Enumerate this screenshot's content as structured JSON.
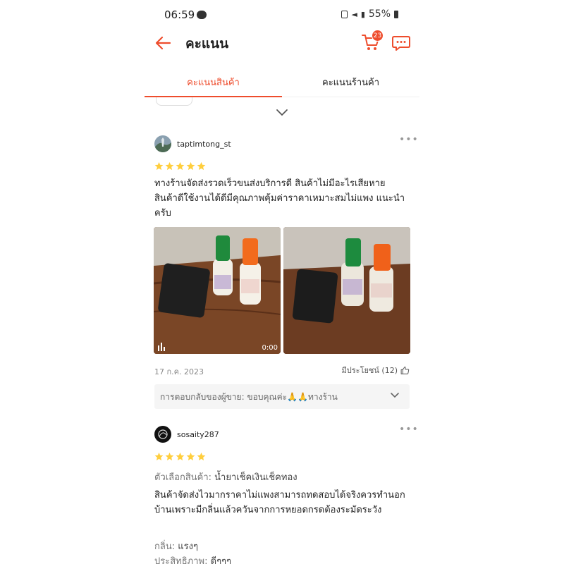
{
  "status": {
    "time": "06:59",
    "battery": "55%"
  },
  "appbar": {
    "title": "คะแนน",
    "cart_count": "23"
  },
  "tabs": [
    {
      "label": "คะแนนสินค้า"
    },
    {
      "label": "คะแนนร้านค้า"
    }
  ],
  "reviews": [
    {
      "username": "taptimtong_st",
      "rating": 5,
      "text": "ทางร้านจัดส่งรวดเร็วขนส่งบริการดี สินค้าไม่มีอะไรเสียหาย สินค้าดีใช้งานได้ดีมีคุณภาพคุ้มค่าราคาเหมาะสมไม่แพง แนะนำครับ",
      "video_duration": "0:00",
      "date": "17 ก.ค. 2023",
      "helpful": "มีประโยชน์ (12)",
      "seller_reply": "การตอบกลับของผู้ขาย: ขอบคุณค่ะ🙏🙏ทางร้าน"
    },
    {
      "username": "sosaity287",
      "rating": 5,
      "variant_label": "ตัวเลือกสินค้า:",
      "variant_value": "น้ำยาเช็คเงินเช็คทอง",
      "text": "สินค้าจัดส่งไวมากราคาไม่แพงสามารถทดสอบได้จริงควรทำนอกบ้านเพราะมีกลิ่นแล้วควันจากการหยอดกรดต้องระมัดระวัง",
      "attr1_label": "กลิ่น:",
      "attr1_value": "แรงๆ",
      "attr2_label": "ประสิทธิภาพ:",
      "attr2_value": "ดีๆๆๆ"
    }
  ],
  "colors": {
    "accent": "#ee4d2d",
    "star": "#ffce3d"
  }
}
